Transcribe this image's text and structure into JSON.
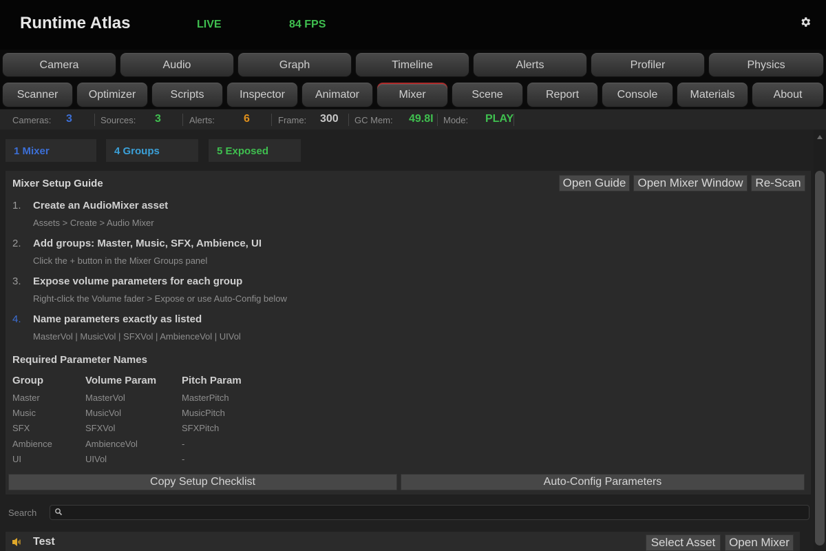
{
  "header": {
    "title": "Runtime Atlas",
    "live": "LIVE",
    "fps": "84 FPS",
    "settings_icon": "gear-icon"
  },
  "tabs_row1": [
    "Camera",
    "Audio",
    "Graph",
    "Timeline",
    "Alerts",
    "Profiler",
    "Physics"
  ],
  "tabs_row2": [
    "Scanner",
    "Optimizer",
    "Scripts",
    "Inspector",
    "Animator",
    "Mixer",
    "Scene",
    "Report",
    "Console",
    "Materials",
    "About"
  ],
  "active_tab": "Mixer",
  "status": {
    "cameras_label": "Cameras:",
    "cameras": "3",
    "sources_label": "Sources:",
    "sources": "3",
    "alerts_label": "Alerts:",
    "alerts": "6",
    "frame_label": "Frame:",
    "frame": "300",
    "gc_label": "GC Mem:",
    "gc": "49.8I",
    "mode_label": "Mode:",
    "mode": "PLAY"
  },
  "summary": {
    "mixers": "1 Mixer",
    "groups": "4 Groups",
    "exposed": "5 Exposed"
  },
  "guide": {
    "title": "Mixer Setup Guide",
    "open_guide": "Open Guide",
    "open_mixer_window": "Open Mixer Window",
    "rescan": "Re-Scan",
    "steps": [
      {
        "num": "1.",
        "title": "Create an AudioMixer asset",
        "desc": "Assets > Create > Audio Mixer"
      },
      {
        "num": "2.",
        "title": "Add groups: Master, Music, SFX, Ambience, UI",
        "desc": "Click the + button in the Mixer Groups panel"
      },
      {
        "num": "3.",
        "title": "Expose volume parameters for each group",
        "desc": "Right-click the Volume fader > Expose  or  use Auto-Config below"
      },
      {
        "num": "4.",
        "title": "Name parameters exactly as listed",
        "desc": "MasterVol  |  MusicVol  |  SFXVol  |  AmbienceVol  |  UIVol"
      }
    ],
    "required_title": "Required Parameter Names",
    "table_headers": [
      "Group",
      "Volume Param",
      "Pitch Param"
    ],
    "table_rows": [
      [
        "Master",
        "MasterVol",
        "MasterPitch"
      ],
      [
        "Music",
        "MusicVol",
        "MusicPitch"
      ],
      [
        "SFX",
        "SFXVol",
        "SFXPitch"
      ],
      [
        "Ambience",
        "AmbienceVol",
        "-"
      ],
      [
        "UI",
        "UIVol",
        "-"
      ]
    ],
    "copy_button": "Copy Setup Checklist",
    "autoconfig_button": "Auto-Config Parameters"
  },
  "search": {
    "label": "Search",
    "value": ""
  },
  "mixer_item": {
    "name": "Test",
    "select_asset": "Select Asset",
    "open_mixer": "Open Mixer"
  },
  "colors": {
    "green": "#3fbf4f",
    "blue": "#3c6fd6",
    "cyan": "#3ba0d8",
    "orange": "#e0901c",
    "active_tab_accent": "#b02a2a"
  }
}
